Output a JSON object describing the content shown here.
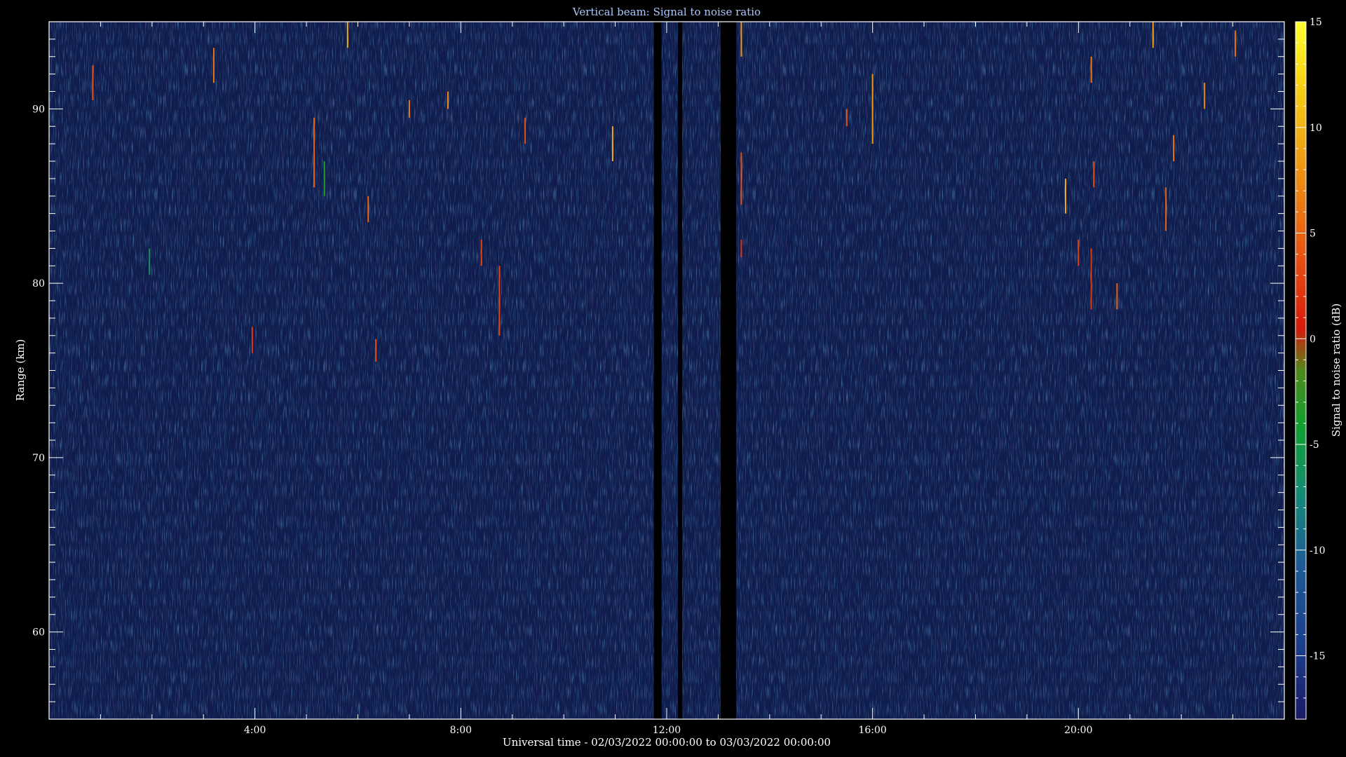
{
  "chart_data": {
    "type": "heatmap",
    "title": "Vertical beam: Signal to noise ratio",
    "xlabel": "Universal time - 02/03/2022 00:00:00 to 03/03/2022 00:00:00",
    "ylabel": "Range (km)",
    "colorbar_label": "Signal to noise ratio (dB)",
    "xlim_hours": [
      0,
      24
    ],
    "ylim": [
      55,
      95
    ],
    "zlim": [
      -18,
      15
    ],
    "x_ticks": [
      {
        "value": 4,
        "label": "4:00"
      },
      {
        "value": 8,
        "label": "8:00"
      },
      {
        "value": 12,
        "label": "12:00"
      },
      {
        "value": 16,
        "label": "16:00"
      },
      {
        "value": 20,
        "label": "20:00"
      }
    ],
    "y_ticks": [
      {
        "value": 60,
        "label": "60"
      },
      {
        "value": 70,
        "label": "70"
      },
      {
        "value": 80,
        "label": "80"
      },
      {
        "value": 90,
        "label": "90"
      }
    ],
    "colorbar_ticks": [
      {
        "value": 15,
        "label": "15"
      },
      {
        "value": 10,
        "label": "10"
      },
      {
        "value": 5,
        "label": "5"
      },
      {
        "value": 0,
        "label": "0"
      },
      {
        "value": -5,
        "label": "-5"
      },
      {
        "value": -10,
        "label": "-10"
      },
      {
        "value": -15,
        "label": "-15"
      }
    ],
    "background_snr_db": -14,
    "data_gaps_hours": [
      [
        11.75,
        11.9
      ],
      [
        12.22,
        12.3
      ],
      [
        13.05,
        13.35
      ]
    ],
    "echoes": [
      {
        "time": 0.85,
        "range_low": 90.5,
        "range_high": 92.5,
        "snr": 4
      },
      {
        "time": 1.95,
        "range_low": 80.5,
        "range_high": 82,
        "snr": -6
      },
      {
        "time": 3.2,
        "range_low": 91.5,
        "range_high": 93.5,
        "snr": 6
      },
      {
        "time": 3.95,
        "range_low": 76,
        "range_high": 77.5,
        "snr": 2
      },
      {
        "time": 5.15,
        "range_low": 85.5,
        "range_high": 89.5,
        "snr": 5
      },
      {
        "time": 5.35,
        "range_low": 85,
        "range_high": 87,
        "snr": -3
      },
      {
        "time": 5.8,
        "range_low": 93.5,
        "range_high": 95,
        "snr": 9
      },
      {
        "time": 6.2,
        "range_low": 83.5,
        "range_high": 85,
        "snr": 5
      },
      {
        "time": 6.35,
        "range_low": 75.5,
        "range_high": 76.8,
        "snr": 4
      },
      {
        "time": 7.0,
        "range_low": 89.5,
        "range_high": 90.5,
        "snr": 6
      },
      {
        "time": 7.75,
        "range_low": 90,
        "range_high": 91,
        "snr": 7
      },
      {
        "time": 8.4,
        "range_low": 81,
        "range_high": 82.5,
        "snr": 3
      },
      {
        "time": 8.75,
        "range_low": 77,
        "range_high": 81,
        "snr": 3
      },
      {
        "time": 9.25,
        "range_low": 88,
        "range_high": 89.5,
        "snr": 4
      },
      {
        "time": 10.95,
        "range_low": 87,
        "range_high": 89,
        "snr": 9
      },
      {
        "time": 13.45,
        "range_low": 84.5,
        "range_high": 87.5,
        "snr": 4
      },
      {
        "time": 13.45,
        "range_low": 93,
        "range_high": 95,
        "snr": 8
      },
      {
        "time": 13.45,
        "range_low": 81.5,
        "range_high": 82.5,
        "snr": 2
      },
      {
        "time": 16.0,
        "range_low": 88,
        "range_high": 92,
        "snr": 8
      },
      {
        "time": 15.5,
        "range_low": 89,
        "range_high": 90,
        "snr": 4
      },
      {
        "time": 19.75,
        "range_low": 84,
        "range_high": 86,
        "snr": 9
      },
      {
        "time": 20.0,
        "range_low": 81,
        "range_high": 82.5,
        "snr": 3
      },
      {
        "time": 20.25,
        "range_low": 91.5,
        "range_high": 93,
        "snr": 6
      },
      {
        "time": 20.25,
        "range_low": 78.5,
        "range_high": 82,
        "snr": 2
      },
      {
        "time": 20.3,
        "range_low": 85.5,
        "range_high": 87,
        "snr": 4
      },
      {
        "time": 20.75,
        "range_low": 78.5,
        "range_high": 80,
        "snr": 5
      },
      {
        "time": 21.45,
        "range_low": 93.5,
        "range_high": 95,
        "snr": 8
      },
      {
        "time": 21.7,
        "range_low": 83,
        "range_high": 85.5,
        "snr": 5
      },
      {
        "time": 21.85,
        "range_low": 87,
        "range_high": 88.5,
        "snr": 6
      },
      {
        "time": 22.45,
        "range_low": 90,
        "range_high": 91.5,
        "snr": 7
      },
      {
        "time": 23.05,
        "range_low": 93,
        "range_high": 94.5,
        "snr": 6
      }
    ]
  }
}
